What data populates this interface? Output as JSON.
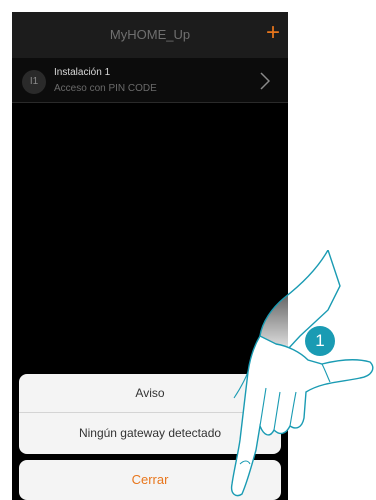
{
  "header": {
    "title": "MyHOME_Up",
    "add_label": "+"
  },
  "installation": {
    "badge": "I1",
    "name": "Instalación 1",
    "subtitle": "Acceso con PIN CODE"
  },
  "dialog": {
    "title": "Aviso",
    "message": "Ningún gateway detectado",
    "close_label": "Cerrar"
  },
  "callout": {
    "step_number": "1"
  },
  "colors": {
    "accent": "#e8761c",
    "step": "#1a9bb3",
    "background": "#000000"
  },
  "icons": {
    "add": "plus-icon",
    "chevron": "chevron-right-icon",
    "hand": "pointing-hand-illustration"
  }
}
